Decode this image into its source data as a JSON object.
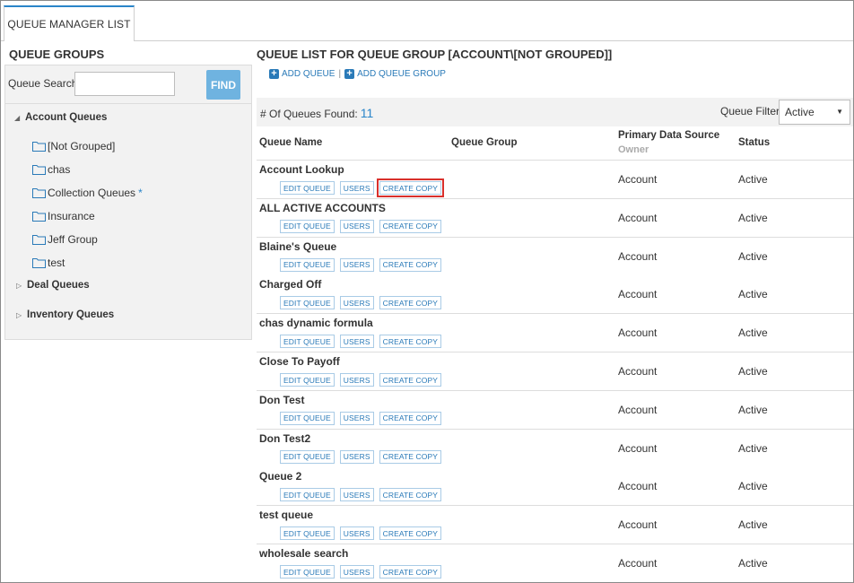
{
  "tab": {
    "label": "QUEUE MANAGER LIST"
  },
  "left": {
    "title": "QUEUE GROUPS",
    "search_label": "Queue Search:",
    "search_value": "",
    "find_label": "FIND",
    "groups": [
      {
        "label": "Account Queues",
        "expanded": true,
        "items": [
          {
            "label": "[Not Grouped]",
            "starred": false
          },
          {
            "label": "chas",
            "starred": false
          },
          {
            "label": "Collection Queues",
            "starred": true
          },
          {
            "label": "Insurance",
            "starred": false
          },
          {
            "label": "Jeff Group",
            "starred": false
          },
          {
            "label": "test",
            "starred": false
          }
        ]
      },
      {
        "label": "Deal Queues",
        "expanded": false
      },
      {
        "label": "Inventory Queues",
        "expanded": false
      }
    ],
    "star_symbol": "*"
  },
  "right": {
    "title": "QUEUE LIST FOR QUEUE GROUP [ACCOUNT\\[NOT GROUPED]]",
    "add_queue": "ADD QUEUE",
    "separator": "|",
    "add_queue_group": "ADD QUEUE GROUP",
    "found_label": "# Of Queues Found:",
    "found_count": "11",
    "filter_label": "Queue Filter:",
    "filter_value": "Active",
    "columns": {
      "name": "Queue Name",
      "group": "Queue Group",
      "source": "Primary Data Source",
      "owner": "Owner",
      "status": "Status"
    },
    "buttons": {
      "edit": "EDIT QUEUE",
      "users": "USERS",
      "copy": "CREATE COPY"
    },
    "rows": [
      {
        "name": "Account Lookup",
        "source": "Account",
        "status": "Active"
      },
      {
        "name": "ALL ACTIVE ACCOUNTS",
        "source": "Account",
        "status": "Active"
      },
      {
        "name": "Blaine's Queue",
        "source": "Account",
        "status": "Active"
      },
      {
        "name": "Charged Off",
        "source": "Account",
        "status": "Active"
      },
      {
        "name": "chas dynamic formula",
        "source": "Account",
        "status": "Active"
      },
      {
        "name": "Close To Payoff",
        "source": "Account",
        "status": "Active"
      },
      {
        "name": "Don Test",
        "source": "Account",
        "status": "Active"
      },
      {
        "name": "Don Test2",
        "source": "Account",
        "status": "Active"
      },
      {
        "name": "Queue 2",
        "source": "Account",
        "status": "Active"
      },
      {
        "name": "test queue",
        "source": "Account",
        "status": "Active"
      },
      {
        "name": "wholesale search",
        "source": "Account",
        "status": "Active"
      }
    ]
  },
  "colors": {
    "accent": "#2a85c9",
    "find_button": "#6fb3e0",
    "highlight": "#d9302c"
  }
}
